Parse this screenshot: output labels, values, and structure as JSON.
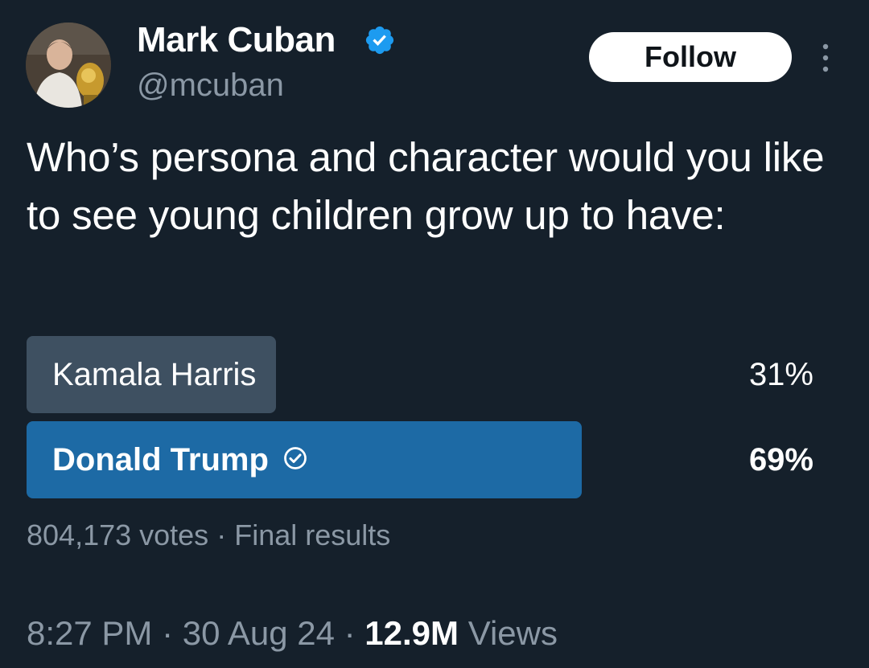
{
  "author": {
    "display_name": "Mark Cuban",
    "handle": "@mcuban",
    "verified": true
  },
  "follow_label": "Follow",
  "tweet_text": "Who’s persona and character would you like to see young children grow up to have:",
  "poll": {
    "options": [
      {
        "label": "Kamala Harris",
        "percent_label": "31%",
        "percent": 31,
        "winner": false
      },
      {
        "label": "Donald Trump",
        "percent_label": "69%",
        "percent": 69,
        "winner": true
      }
    ],
    "votes": "804,173 votes",
    "separator": "·",
    "status": "Final results"
  },
  "meta": {
    "time": "8:27 PM",
    "date": "30 Aug 24",
    "views_count": "12.9M",
    "views_label": "Views",
    "separator": "·"
  },
  "colors": {
    "background": "#15202b",
    "loser_bar": "#3e5061",
    "winner_bar": "#1d6aa5",
    "verified_badge": "#1d9bf0",
    "secondary_text": "#8b98a5"
  },
  "icons": [
    "avatar",
    "verified-badge-icon",
    "more-options-icon",
    "check-circle-icon"
  ]
}
